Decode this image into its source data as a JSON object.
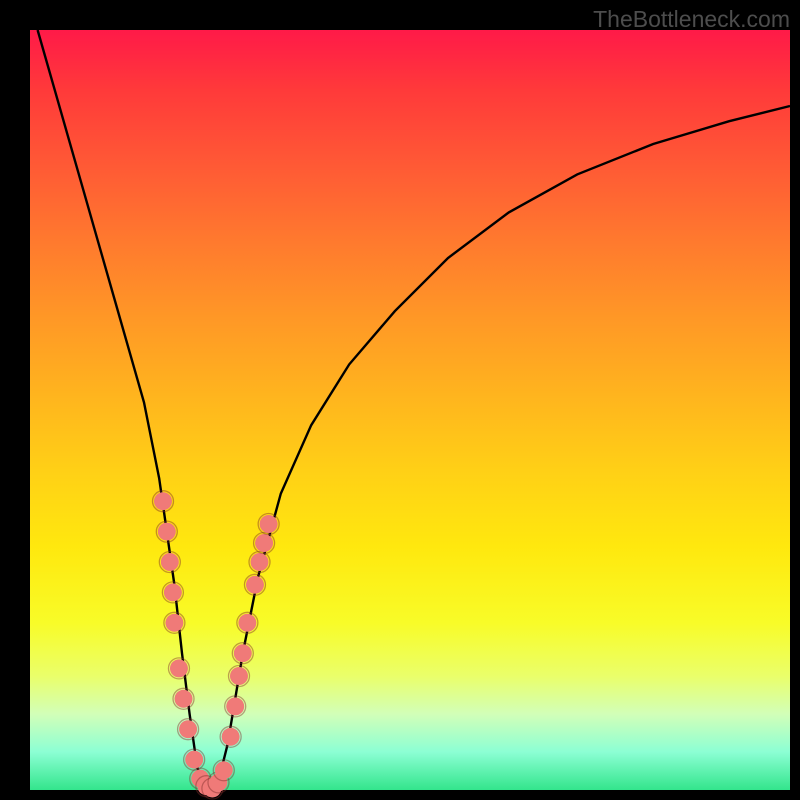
{
  "watermark": "TheBottleneck.com",
  "colors": {
    "frame_bg": "#000000",
    "curve": "#000000",
    "bead_fill": "#f07a78",
    "bead_stroke": "#812c2a"
  },
  "chart_data": {
    "type": "line",
    "title": "",
    "xlabel": "",
    "ylabel": "",
    "xlim": [
      0,
      100
    ],
    "ylim": [
      0,
      100
    ],
    "grid": false,
    "legend": false,
    "annotations": [
      "TheBottleneck.com"
    ],
    "series": [
      {
        "name": "bottleneck-curve",
        "x": [
          1,
          3,
          5,
          7,
          9,
          11,
          13,
          15,
          17,
          18,
          19,
          20,
          21,
          22,
          23,
          24,
          25,
          26,
          27,
          28,
          30,
          33,
          37,
          42,
          48,
          55,
          63,
          72,
          82,
          92,
          100
        ],
        "y": [
          100,
          93,
          86,
          79,
          72,
          65,
          58,
          51,
          41,
          34,
          27,
          18,
          10,
          3,
          0,
          0,
          2,
          6,
          12,
          18,
          28,
          39,
          48,
          56,
          63,
          70,
          76,
          81,
          85,
          88,
          90
        ]
      }
    ],
    "marker_clusters": [
      {
        "name": "left-branch-beads",
        "approx_points": [
          {
            "x": 17.5,
            "y": 38
          },
          {
            "x": 18.0,
            "y": 34
          },
          {
            "x": 18.4,
            "y": 30
          },
          {
            "x": 18.8,
            "y": 26
          },
          {
            "x": 19.0,
            "y": 22
          },
          {
            "x": 19.6,
            "y": 16
          },
          {
            "x": 20.2,
            "y": 12
          },
          {
            "x": 20.8,
            "y": 8
          },
          {
            "x": 21.6,
            "y": 4
          }
        ]
      },
      {
        "name": "bottom-beads",
        "approx_points": [
          {
            "x": 22.4,
            "y": 1.5
          },
          {
            "x": 23.2,
            "y": 0.5
          },
          {
            "x": 24.0,
            "y": 0.2
          },
          {
            "x": 24.8,
            "y": 1.0
          },
          {
            "x": 25.5,
            "y": 2.6
          }
        ]
      },
      {
        "name": "right-branch-beads",
        "approx_points": [
          {
            "x": 26.4,
            "y": 7
          },
          {
            "x": 27.0,
            "y": 11
          },
          {
            "x": 27.5,
            "y": 15
          },
          {
            "x": 28.0,
            "y": 18
          },
          {
            "x": 28.6,
            "y": 22
          },
          {
            "x": 29.6,
            "y": 27
          },
          {
            "x": 30.2,
            "y": 30
          },
          {
            "x": 30.8,
            "y": 32.5
          },
          {
            "x": 31.4,
            "y": 35
          }
        ]
      }
    ]
  }
}
